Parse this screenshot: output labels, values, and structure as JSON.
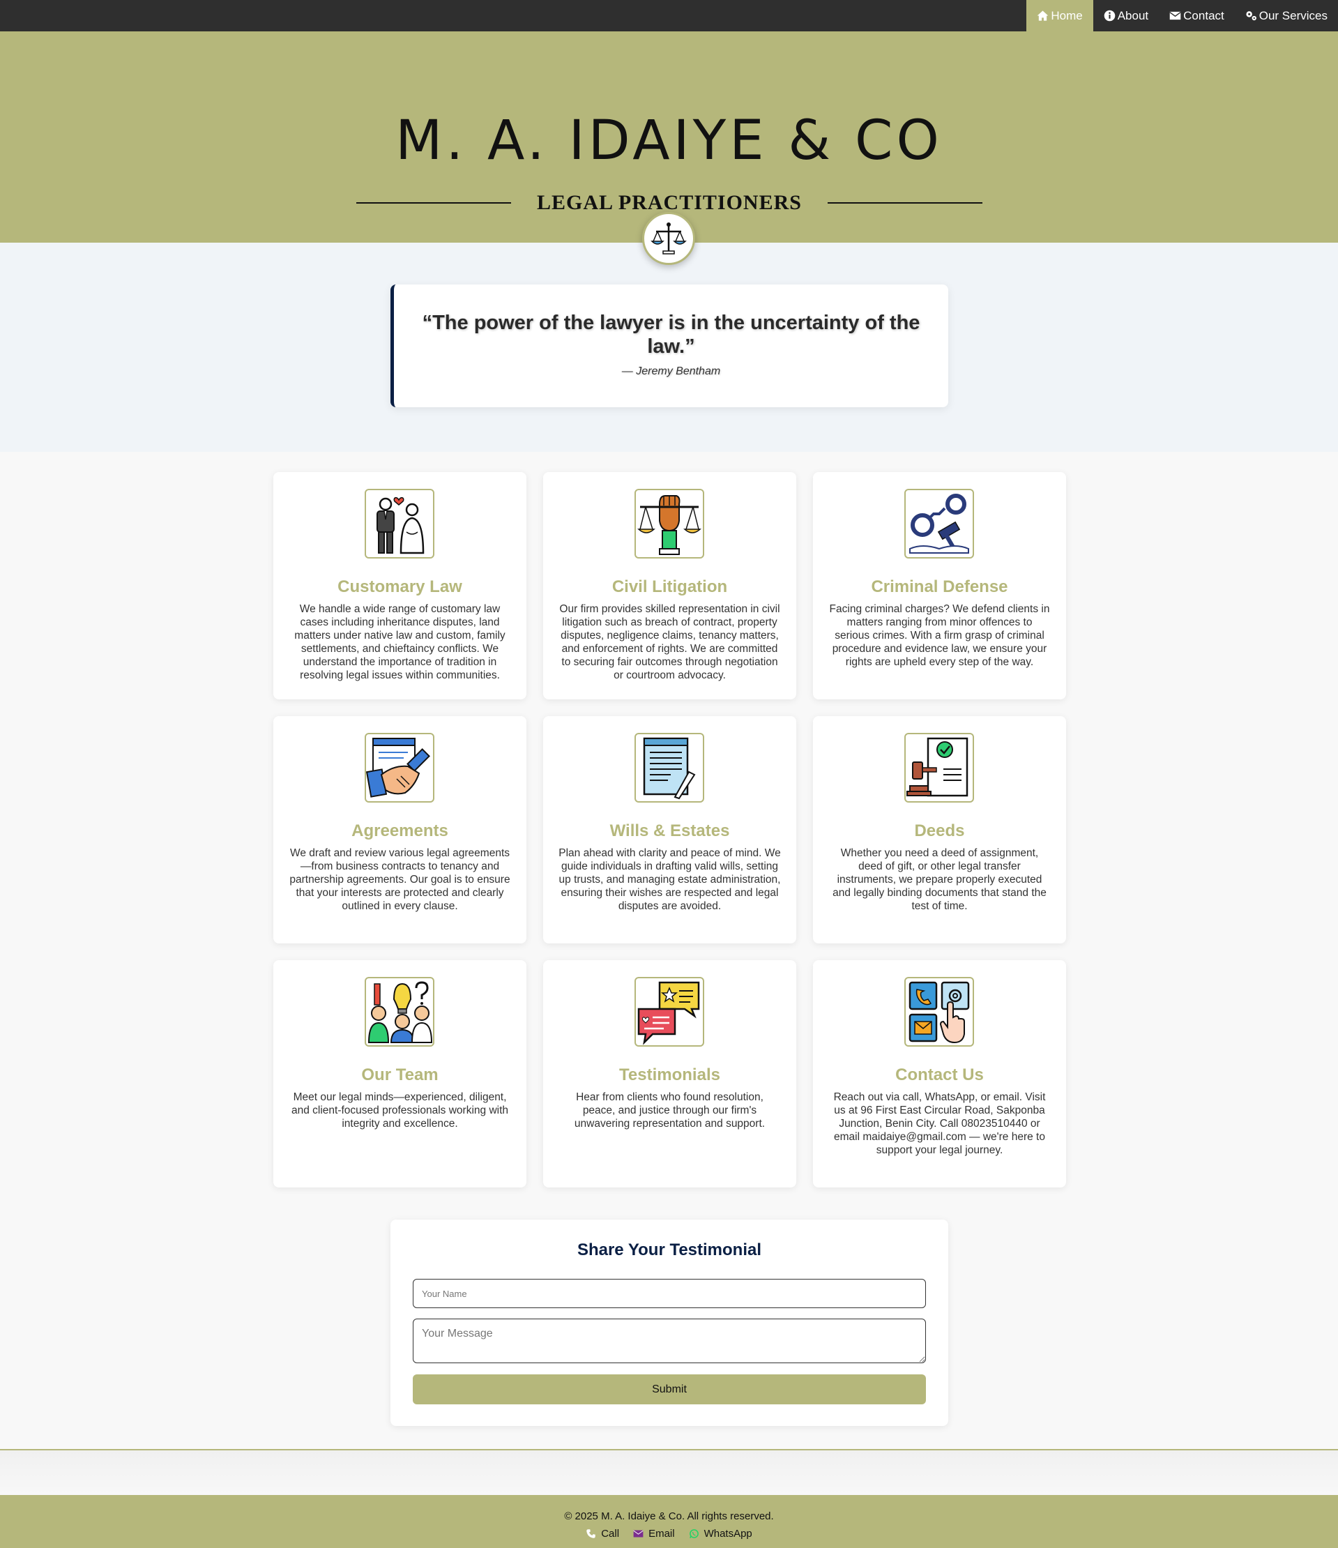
{
  "nav": {
    "items": [
      {
        "label": "Home",
        "icon": "home-icon",
        "active": true
      },
      {
        "label": "About",
        "icon": "info-icon",
        "active": false
      },
      {
        "label": "Contact",
        "icon": "envelope-icon",
        "active": false
      },
      {
        "label": " Our Services",
        "icon": "gears-icon",
        "active": false
      }
    ]
  },
  "hero": {
    "title": "M. A. IDAIYE & CO",
    "subtitle": "LEGAL PRACTITIONERS",
    "badge_icon": "scales-of-justice-icon"
  },
  "quote": {
    "text": "“The power of the lawyer is in the uncertainty of the law.”",
    "author": "— Jeremy Bentham"
  },
  "services": [
    {
      "title": "Customary Law",
      "icon": "couple-heart-icon",
      "text": "We handle a wide range of customary law cases including inheritance disputes, land matters under native law and custom, family settlements, and chieftaincy conflicts. We understand the importance of tradition in resolving legal issues within communities."
    },
    {
      "title": "Civil Litigation",
      "icon": "fist-scales-icon",
      "text": "Our firm provides skilled representation in civil litigation such as breach of contract, property disputes, negligence claims, tenancy matters, and enforcement of rights. We are committed to securing fair outcomes through negotiation or courtroom advocacy."
    },
    {
      "title": "Criminal Defense",
      "icon": "handcuffs-gavel-icon",
      "text": "Facing criminal charges? We defend clients in matters ranging from minor offences to serious crimes. With a firm grasp of criminal procedure and evidence law, we ensure your rights are upheld every step of the way."
    },
    {
      "title": "Agreements",
      "icon": "handshake-contract-icon",
      "text": "We draft and review various legal agreements—from business contracts to tenancy and partnership agreements. Our goal is to ensure that your interests are protected and clearly outlined in every clause."
    },
    {
      "title": "Wills & Estates",
      "icon": "document-pen-icon",
      "text": "Plan ahead with clarity and peace of mind. We guide individuals in drafting valid wills, setting up trusts, and managing estate administration, ensuring their wishes are respected and legal disputes are avoided."
    },
    {
      "title": "Deeds",
      "icon": "gavel-certificate-icon",
      "text": "Whether you need a deed of assignment, deed of gift, or other legal transfer instruments, we prepare properly executed and legally binding documents that stand the test of time."
    },
    {
      "title": "Our Team",
      "icon": "team-idea-icon",
      "text": "Meet our legal minds—experienced, diligent, and client-focused professionals working with integrity and excellence."
    },
    {
      "title": "Testimonials",
      "icon": "chat-bubbles-icon",
      "text": "Hear from clients who found resolution, peace, and justice through our firm's unwavering representation and support."
    },
    {
      "title": "Contact Us",
      "icon": "contact-tiles-icon",
      "text": "Reach out via call, WhatsApp, or email. Visit us at 96 First East Circular Road, Sakponba Junction, Benin City. Call 08023510440 or email maidaiye@gmail.com — we're here to support your legal journey."
    }
  ],
  "testimonial_form": {
    "title": "Share Your Testimonial",
    "name_placeholder": "Your Name",
    "message_placeholder": "Your Message",
    "submit_label": "Submit"
  },
  "footer": {
    "copyright": "© 2025 M. A. Idaiye & Co. All rights reserved.",
    "links": [
      {
        "label": "Call",
        "icon": "phone-icon"
      },
      {
        "label": "Email",
        "icon": "envelope-icon"
      },
      {
        "label": "WhatsApp",
        "icon": "whatsapp-icon"
      }
    ]
  },
  "colors": {
    "accent": "#b5b77b",
    "navbar": "#2f2f2f",
    "navy": "#0a1f44"
  }
}
